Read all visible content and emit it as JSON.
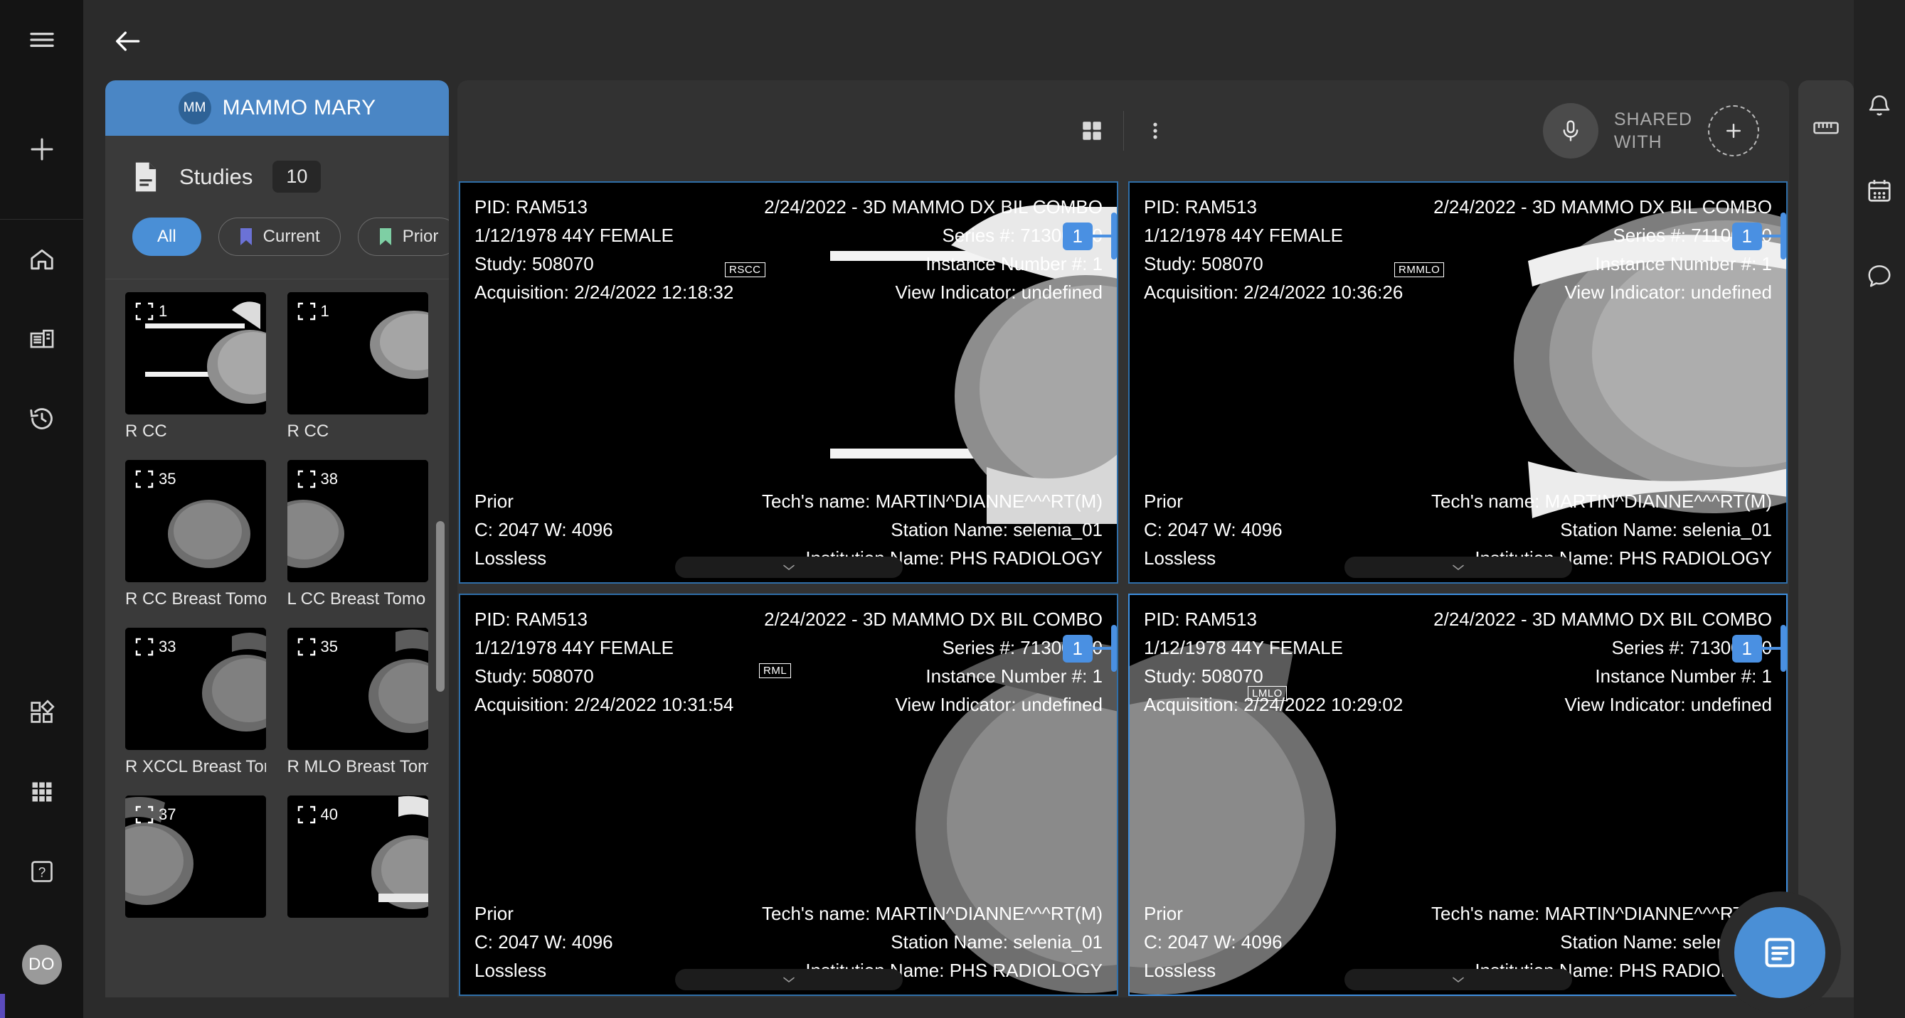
{
  "app": {
    "title": "Mammography Viewer",
    "accent_blue": "#4a8fd6",
    "header_blue": "#4a86c5",
    "panel_gray": "#3a3a3a",
    "viewer_gray": "#323232",
    "rail_black": "#141414"
  },
  "left_rail": {
    "items": [
      {
        "name": "menu-icon",
        "label": "Menu"
      },
      {
        "name": "plus-icon",
        "label": "Add"
      },
      {
        "name": "home-icon",
        "label": "Home"
      },
      {
        "name": "worklist-icon",
        "label": "Worklist"
      },
      {
        "name": "history-icon",
        "label": "History"
      },
      {
        "name": "apps-diamond-icon",
        "label": "Apps"
      },
      {
        "name": "grid-dots-icon",
        "label": "Grid"
      },
      {
        "name": "help-icon",
        "label": "Help"
      }
    ],
    "user_initials": "DO"
  },
  "topbar": {
    "back_label": "Back",
    "back_icon": "arrow-left-icon"
  },
  "study_panel": {
    "patient": {
      "initials": "MM",
      "name": "MAMMO MARY"
    },
    "studies": {
      "icon": "document-icon",
      "label": "Studies",
      "count": "10"
    },
    "filters": [
      {
        "label": "All",
        "active": true,
        "marker": null
      },
      {
        "label": "Current",
        "active": false,
        "marker": "#6b72d6"
      },
      {
        "label": "Prior",
        "active": false,
        "marker": "#7ecfa4"
      }
    ],
    "thumbnails": [
      {
        "badge": "1",
        "label": "R CC",
        "view": "rcc"
      },
      {
        "badge": "1",
        "label": "R CC",
        "view": "rcc2"
      },
      {
        "badge": "35",
        "label": "R CC Breast Tomo",
        "view": "tomo-a"
      },
      {
        "badge": "38",
        "label": "L CC Breast Tomo",
        "view": "tomo-b"
      },
      {
        "badge": "33",
        "label": "R XCCL Breast Tomo",
        "view": "tomo-c"
      },
      {
        "badge": "35",
        "label": "R MLO Breast Tomo",
        "view": "tomo-d"
      },
      {
        "badge": "37",
        "label": "",
        "view": "tomo-e"
      },
      {
        "badge": "40",
        "label": "",
        "view": "tomo-f"
      }
    ]
  },
  "viewer": {
    "toolbar": {
      "layout_icon": "grid-layout-icon",
      "more_icon": "more-vertical-icon",
      "mic_icon": "microphone-icon",
      "shared_with_line1": "SHARED",
      "shared_with_line2": "WITH",
      "add_icon": "plus-icon"
    },
    "viewports": [
      {
        "pid": "PID: RAM513",
        "dob": "1/12/1978 44Y FEMALE",
        "study": "Study: 508070",
        "acquisition": "Acquisition: 2/24/2022 12:18:32",
        "description": "2/24/2022 - 3D MAMMO DX BIL COMBO",
        "series": "Series #: 71300000",
        "instance": "Instance Number #: 1",
        "view_indicator": "View Indicator: undefined",
        "priority": "Prior",
        "window": "C: 2047 W: 4096",
        "compression": "Lossless",
        "tech": "Tech's name: MARTIN^DIANNE^^^RT(M)",
        "station": "Station Name: selenia_01",
        "institution": "Institution Name: PHS RADIOLOGY",
        "laterality": "RSCC",
        "scroll_badge": "1",
        "selected": false
      },
      {
        "pid": "PID: RAM513",
        "dob": "1/12/1978 44Y FEMALE",
        "study": "Study: 508070",
        "acquisition": "Acquisition: 2/24/2022 10:36:26",
        "description": "2/24/2022 - 3D MAMMO DX BIL COMBO",
        "series": "Series #: 71100000",
        "instance": "Instance Number #: 1",
        "view_indicator": "View Indicator: undefined",
        "priority": "Prior",
        "window": "C: 2047 W: 4096",
        "compression": "Lossless",
        "tech": "Tech's name: MARTIN^DIANNE^^^RT(M)",
        "station": "Station Name: selenia_01",
        "institution": "Institution Name: PHS RADIOLOGY",
        "laterality": "RMMLO",
        "scroll_badge": "1",
        "selected": false
      },
      {
        "pid": "PID: RAM513",
        "dob": "1/12/1978 44Y FEMALE",
        "study": "Study: 508070",
        "acquisition": "Acquisition: 2/24/2022 10:31:54",
        "description": "2/24/2022 - 3D MAMMO DX BIL COMBO",
        "series": "Series #: 71300000",
        "instance": "Instance Number #: 1",
        "view_indicator": "View Indicator: undefined",
        "priority": "Prior",
        "window": "C: 2047 W: 4096",
        "compression": "Lossless",
        "tech": "Tech's name: MARTIN^DIANNE^^^RT(M)",
        "station": "Station Name: selenia_01",
        "institution": "Institution Name: PHS RADIOLOGY",
        "laterality": "RML",
        "scroll_badge": "1",
        "selected": false
      },
      {
        "pid": "PID: RAM513",
        "dob": "1/12/1978 44Y FEMALE",
        "study": "Study: 508070",
        "acquisition": "Acquisition: 2/24/2022 10:29:02",
        "description": "2/24/2022 - 3D MAMMO DX BIL COMBO",
        "series": "Series #: 71300000",
        "instance": "Instance Number #: 1",
        "view_indicator": "View Indicator: undefined",
        "priority": "Prior",
        "window": "C: 2047 W: 4096",
        "compression": "Lossless",
        "tech": "Tech's name: MARTIN^DIANNE^^^RT(M)",
        "station": "Station Name: selenia_01",
        "institution": "Institution Name: PHS RADIOLOGY",
        "laterality": "LMLO",
        "scroll_badge": "1",
        "selected": true
      }
    ]
  },
  "tools_panel": {
    "items": [
      {
        "name": "ruler-icon",
        "label": "Measure"
      }
    ]
  },
  "right_rail": {
    "items": [
      {
        "name": "bell-icon",
        "label": "Notifications"
      },
      {
        "name": "calendar-icon",
        "label": "Calendar"
      },
      {
        "name": "chat-icon",
        "label": "Chat"
      }
    ]
  },
  "fab": {
    "name": "report-icon",
    "label": "Report"
  }
}
